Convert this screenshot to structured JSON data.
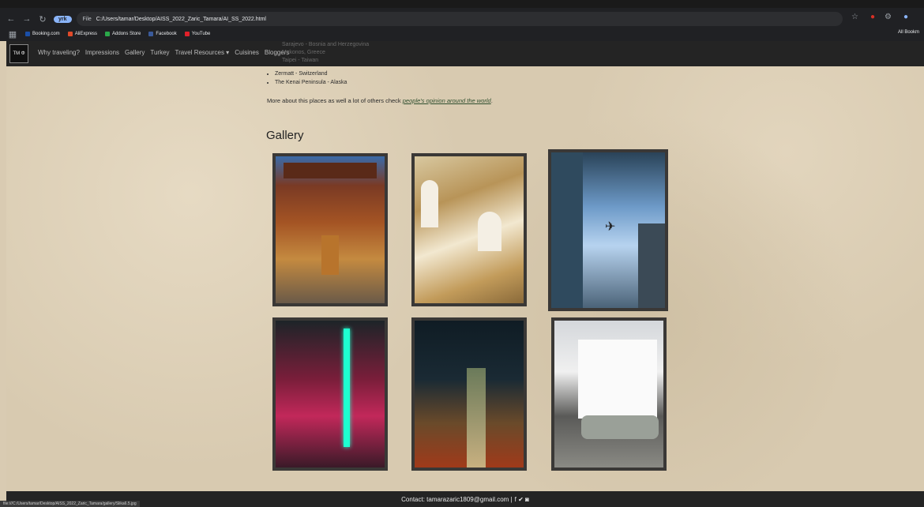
{
  "browser": {
    "ext_chip": "yrk",
    "url_scheme": "File",
    "url": "C:/Users/tamar/Desktop/AISS_2022_Zaric_Tamara/AI_SS_2022.html",
    "bookmarks": [
      "Booking.com",
      "AliExpress",
      "Addons Store",
      "Facebook",
      "YouTube"
    ],
    "bookmark_colors": [
      "#1a4fa8",
      "#e04a2a",
      "#2aa84a",
      "#3a5a9a",
      "#e0202a"
    ],
    "all_bookmarks": "All Bookm",
    "status_url": "file:///C:/Users/tamar/Desktop/AISS_2022_Zaric_Tamara/gallery/Slika6.5.jpg"
  },
  "site": {
    "logo": "TM Φ",
    "nav": [
      "Why traveling?",
      "Impressions",
      "Gallery",
      "Turkey",
      "Travel Resources ▾",
      "Cuisines",
      "Bloggers"
    ],
    "peek_lines": [
      "Sarajevo - Bosnia and Herzegovina",
      "Mykonos, Greece",
      "Taipei - Taiwan"
    ],
    "destinations": [
      "Zermatt - Switzerland",
      "The Kenai Peninsula - Alaska"
    ],
    "more_text": "More about this places as well a lot of others check",
    "more_link": "people's opinion around the world",
    "more_end": ".",
    "gallery_title": "Gallery",
    "footer_contact": "Contact: tamarazaric1809@gmail.com |",
    "footer_icons": "f ✔ ◙"
  }
}
